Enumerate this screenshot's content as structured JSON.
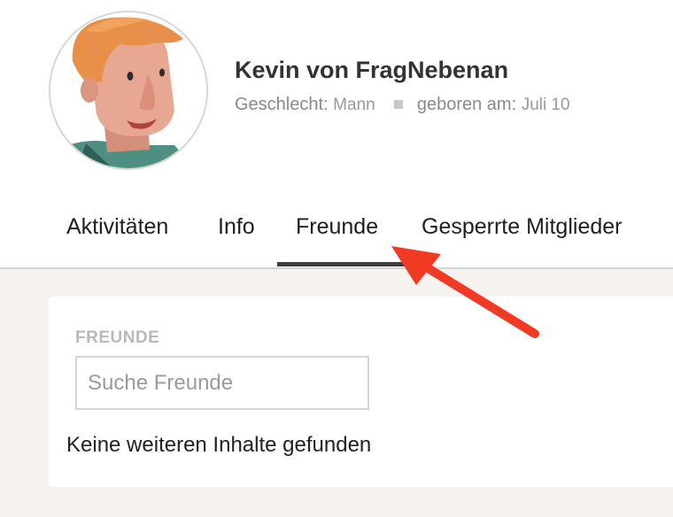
{
  "profile": {
    "name": "Kevin von FragNebenan",
    "gender_label": "Geschlecht:",
    "gender_value": "Mann",
    "birth_label": "geboren am:",
    "birth_value": "Juli 10"
  },
  "tabs": [
    {
      "label": "Aktivitäten",
      "active": false
    },
    {
      "label": "Info",
      "active": false
    },
    {
      "label": "Freunde",
      "active": true
    },
    {
      "label": "Gesperrte Mitglieder",
      "active": false
    }
  ],
  "friends_panel": {
    "heading": "FREUNDE",
    "search_placeholder": "Suche Freunde",
    "search_value": "",
    "empty_message": "Keine weiteren Inhalte gefunden"
  },
  "annotation": {
    "arrow_color": "#f03a24",
    "points_to": "tab-freunde"
  },
  "colors": {
    "content_background": "#f6f3ee",
    "tab_underline": "#3d3d3d"
  }
}
